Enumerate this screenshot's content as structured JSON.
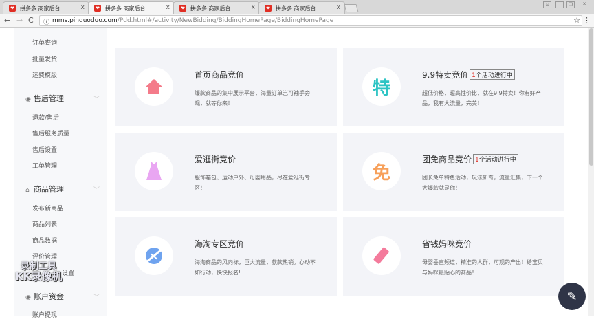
{
  "browser": {
    "tabs": [
      {
        "title": "拼多多 商家后台"
      },
      {
        "title": "拼多多 商家后台"
      },
      {
        "title": "拼多多 商家后台"
      },
      {
        "title": "拼多多 商家后台"
      }
    ],
    "url_host": "mms.pinduoduo.com",
    "url_path": "/Pdd.html#/activity/NewBidding/BiddingHomePage/BiddingHomePage"
  },
  "sidebar": {
    "items_top": [
      "订单查询",
      "批量发货",
      "运费模版"
    ],
    "groups": [
      {
        "label": "售后管理",
        "items": [
          "退款/售后",
          "售后服务质量",
          "售后设置",
          "工单管理"
        ]
      },
      {
        "label": "商品管理",
        "items": [
          "发布新商品",
          "商品列表",
          "商品数据",
          "评价管理",
          "设置"
        ]
      },
      {
        "label": "账户资金",
        "items": [
          "账户提现"
        ]
      }
    ]
  },
  "cards": [
    {
      "title": "首页商品竞价",
      "desc": "爆款商品的集中展示平台，海量订单岂可袖手旁观，就等你来！",
      "icon": "home-icon",
      "color": "#f47b8a"
    },
    {
      "title": "9.9特卖竞价",
      "badge_num": "1",
      "badge_text": "个活动进行中",
      "desc": "超低价格，超高性价比，就在9.9特卖！你有好产品，我有大流量，完美！",
      "icon_char": "特",
      "color": "#2ec4c4"
    },
    {
      "title": "爱逛街竞价",
      "desc": "服饰箱包、运动户外、母婴用品，尽在爱逛街专区！",
      "icon": "dress-icon",
      "color": "#e9a6f2"
    },
    {
      "title": "团免商品竞价",
      "badge_num": "1",
      "badge_text": "个活动进行中",
      "desc": "团长免单特色活动，玩法新奇，流量汇集，下一个大爆款就是你！",
      "icon_char": "免",
      "color": "#f7a05a"
    },
    {
      "title": "海淘专区竞价",
      "desc": "海淘商品的风向标，巨大流量，款款热销。心动不如行动，快快报名!",
      "icon": "plane-globe-icon",
      "color": "#6fa3ef"
    },
    {
      "title": "省钱妈咪竞价",
      "desc": "母婴垂直频道，精准的人群，可观的产出！给宝贝与妈咪最贴心的商品！",
      "icon": "baby-bottle-icon",
      "color": "#f47b9c"
    }
  ],
  "watermark": {
    "line1": "录制工具",
    "line2": "KK录像机"
  }
}
